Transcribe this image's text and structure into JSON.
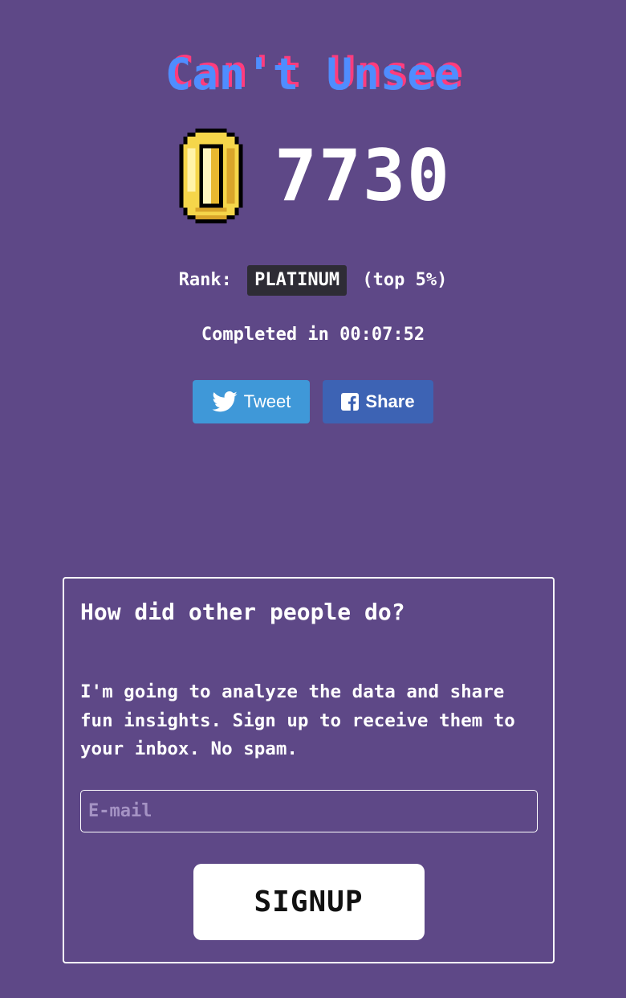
{
  "app": {
    "title": "Can't Unsee"
  },
  "result": {
    "score": "7730",
    "coin_icon": "coin-icon",
    "rank_prefix": "Rank:",
    "rank": "PLATINUM",
    "rank_suffix": "(top 5%)",
    "completed_text": "Completed in 00:07:52"
  },
  "share": {
    "tweet_label": "Tweet",
    "tweet_icon": "twitter-bird-icon",
    "tweet_color": "#3f98d8",
    "share_label": "Share",
    "share_icon": "facebook-icon",
    "share_color": "#3d63b4"
  },
  "signup_card": {
    "title": "How did other people do?",
    "description": "I'm going to analyze the data and share fun insights. Sign up to receive them to your inbox. No spam.",
    "email_placeholder": "E-mail",
    "email_value": "",
    "signup_label": "SIGNUP"
  },
  "colors": {
    "background": "#5e4887",
    "title_blue": "#4f8dff",
    "title_pink": "#ff3c7d",
    "rank_badge": "#2e2c35"
  }
}
